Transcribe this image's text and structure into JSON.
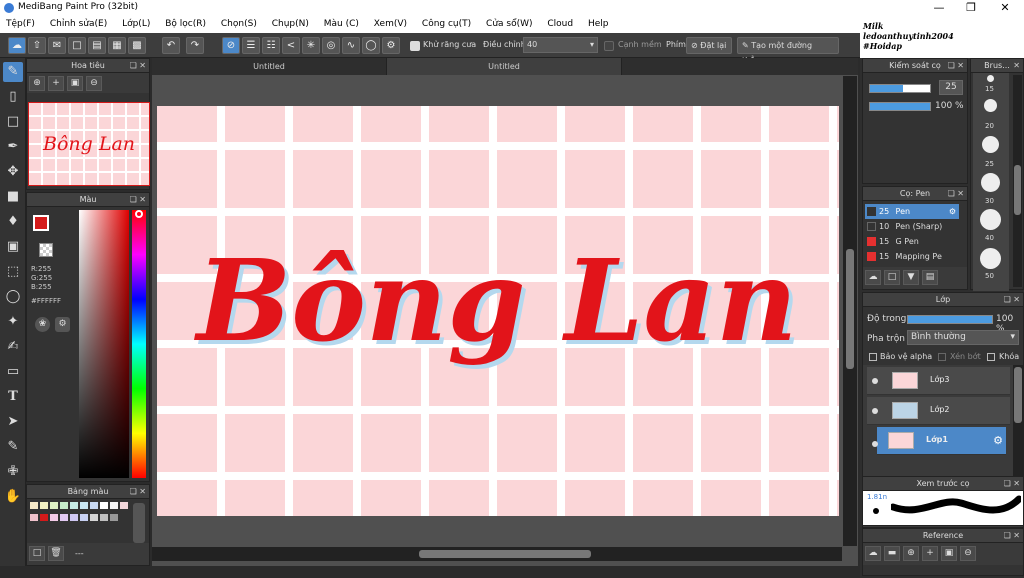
{
  "app": {
    "title": "MediBang Paint Pro (32bit)"
  },
  "menu": [
    "Tệp(F)",
    "Chỉnh sửa(E)",
    "Lớp(L)",
    "Bộ lọc(R)",
    "Chọn(S)",
    "Chụp(N)",
    "Màu (C)",
    "Xem(V)",
    "Công cụ(T)",
    "Cửa sổ(W)",
    "Cloud",
    "Help"
  ],
  "watermark": {
    "line1": "Milk",
    "line2": "ledoanthuytinh2004",
    "line3": "#Hoidap"
  },
  "toolbar": {
    "antialias_label": "Khử răng cưa",
    "adjust_label": "Điều chỉnh",
    "adjust_value": "40",
    "smooth_label": "Cạnh mềm",
    "key_label": "Phím",
    "reset_label": "Đặt lại",
    "line_label": "Tạo một đường thẳng"
  },
  "navigator": {
    "title": "Hoa tiêu"
  },
  "color": {
    "title": "Màu",
    "r": "R:255",
    "g": "G:255",
    "b": "B:255",
    "hex": "#FFFFFF",
    "primary": "#d41a1a",
    "secondary": "#ffffff"
  },
  "palette": {
    "title": "Bảng màu",
    "empty": "---",
    "colors": [
      "#f6e9c7",
      "#f2f0c2",
      "#dff1c4",
      "#c6ecc9",
      "#c6ebe4",
      "#c9e6f2",
      "#c7d8f2",
      "#ffffff",
      "#f6f6f6",
      "#f2d6da",
      "#f0c2cc",
      "#d41a1a",
      "#f4cbe8",
      "#e2c9f2",
      "#cfc7f2",
      "#c7d0f2",
      "#d6d6d6",
      "#bfbfbf",
      "#999999"
    ]
  },
  "tabs": [
    {
      "label": "Untitled"
    },
    {
      "label": "Untitled"
    }
  ],
  "canvas_text": "Bông Lan",
  "brush_control": {
    "title": "Kiểm soát cọ",
    "size": "25",
    "opacity": "100 %",
    "size_fraction": 0.55,
    "opacity_fraction": 1.0
  },
  "brush_sizes": {
    "title": "Brus...",
    "labels": [
      "15",
      "20",
      "25",
      "30",
      "40",
      "50"
    ]
  },
  "brush_list": {
    "title": "Cọ: Pen",
    "items": [
      {
        "size": "25",
        "name": "Pen",
        "color": "#333333"
      },
      {
        "size": "10",
        "name": "Pen (Sharp)",
        "color": "#333333"
      },
      {
        "size": "15",
        "name": "G Pen",
        "color": "#e53030"
      },
      {
        "size": "15",
        "name": "Mapping Pe",
        "color": "#e53030"
      }
    ]
  },
  "layers": {
    "title": "Lớp",
    "opacity_label": "Độ trong",
    "opacity_value": "100 %",
    "blend_label": "Pha trộn",
    "blend_value": "Bình thường",
    "protect_alpha": "Bảo vệ alpha",
    "clip": "Xén bớt",
    "lock": "Khóa",
    "items": [
      {
        "name": "Lớp3"
      },
      {
        "name": "Lớp2"
      },
      {
        "name": "Lớp1"
      }
    ]
  },
  "preview": {
    "title": "Xem trước cọ",
    "size": "1.81n"
  },
  "reference": {
    "title": "Reference"
  }
}
